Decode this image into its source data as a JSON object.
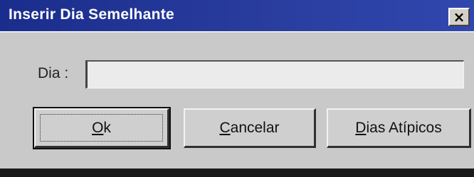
{
  "window": {
    "title": "Inserir Dia Semelhante",
    "close_glyph": "×"
  },
  "form": {
    "dia_label": "Dia :",
    "dia_value": "",
    "dia_placeholder": ""
  },
  "buttons": {
    "ok": {
      "mnemonic": "O",
      "rest": "k"
    },
    "cancelar": {
      "mnemonic": "C",
      "rest": "ancelar"
    },
    "atipicos": {
      "mnemonic": "D",
      "rest": "ias Atípicos"
    }
  },
  "colors": {
    "titlebar": "#1a2d8c",
    "dialog_bg": "#c9c9c9"
  },
  "icons": {
    "close": "close-icon"
  }
}
